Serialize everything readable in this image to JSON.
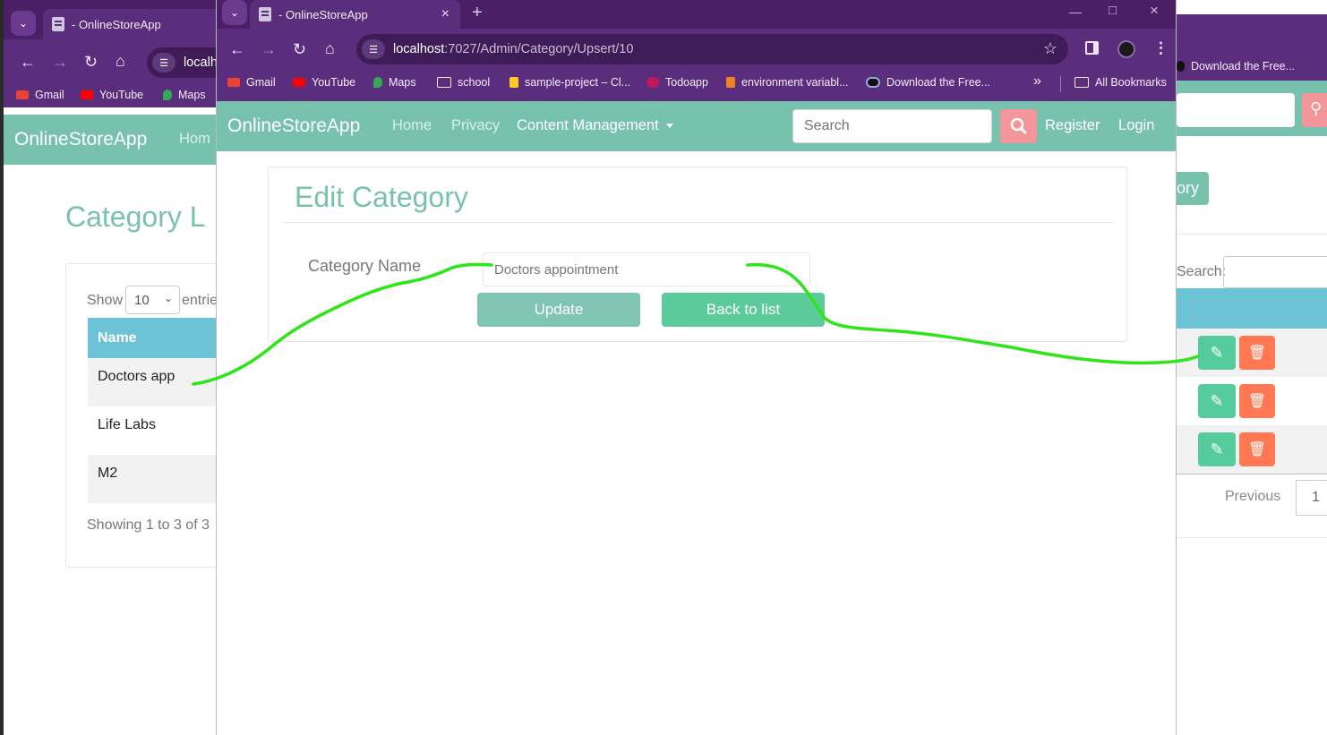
{
  "browser": {
    "tab_title": "- OnlineStoreApp",
    "new_tab_symbol": "+",
    "url_host": "localhost",
    "url_path": ":7027/Admin/Category/Upsert/10",
    "left_url_fragment": "localho",
    "bookmarks": [
      "Gmail",
      "YouTube",
      "Maps",
      "school",
      "sample-project – Cl...",
      "Todoapp",
      "environment variabl...",
      "Download the Free...",
      "All Bookmarks"
    ],
    "more_bookmarks_symbol": "»"
  },
  "app": {
    "brand": "OnlineStoreApp",
    "nav": {
      "home": "Home",
      "privacy": "Privacy",
      "content_management": "Content Management",
      "register": "Register",
      "login": "Login",
      "home_fragment": "Hom"
    },
    "search_placeholder": "Search"
  },
  "edit_form": {
    "title": "Edit Category",
    "label": "Category Name",
    "value": "Doctors appointment",
    "update_button": "Update",
    "back_button": "Back to list"
  },
  "category_list": {
    "title_fragment": "Category L",
    "show_label": "Show",
    "page_size": "10",
    "entries_fragment": "entrie",
    "column_name": "Name",
    "rows": [
      "Doctors app",
      "Life Labs",
      "M2"
    ],
    "showing_fragment": "Showing 1 to 3 of 3",
    "search_label": "Search:",
    "create_button_fragment": "ory",
    "previous": "Previous",
    "page_number": "1"
  },
  "colors": {
    "browser_frame": "#5b2d7d",
    "brand_accent": "#78c2ad",
    "edit_action": "#56cc9d",
    "delete_action": "#ff7851",
    "table_header": "#6cc3d5",
    "annotation": "#2ee51a"
  }
}
